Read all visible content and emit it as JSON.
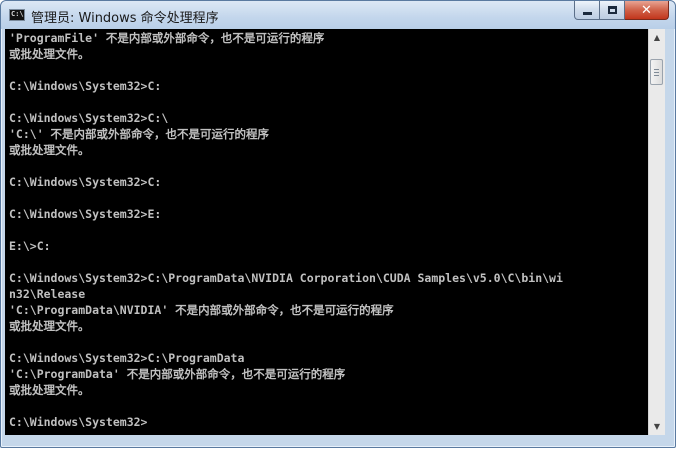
{
  "window": {
    "title": "管理员: Windows 命令处理程序",
    "icon_text": "C:\\",
    "buttons": {
      "minimize": "minimize-icon",
      "maximize": "maximize-icon",
      "close": "close-icon"
    }
  },
  "console": {
    "lines": [
      "'ProgramFile' 不是内部或外部命令，也不是可运行的程序",
      "或批处理文件。",
      "",
      "C:\\Windows\\System32>C:",
      "",
      "C:\\Windows\\System32>C:\\",
      "'C:\\' 不是内部或外部命令，也不是可运行的程序",
      "或批处理文件。",
      "",
      "C:\\Windows\\System32>C:",
      "",
      "C:\\Windows\\System32>E:",
      "",
      "E:\\>C:",
      "",
      "C:\\Windows\\System32>C:\\ProgramData\\NVIDIA Corporation\\CUDA Samples\\v5.0\\C\\bin\\wi",
      "n32\\Release",
      "'C:\\ProgramData\\NVIDIA' 不是内部或外部命令，也不是可运行的程序",
      "或批处理文件。",
      "",
      "C:\\Windows\\System32>C:\\ProgramData",
      "'C:\\ProgramData' 不是内部或外部命令，也不是可运行的程序",
      "或批处理文件。",
      "",
      "C:\\Windows\\System32>"
    ]
  },
  "colors": {
    "console_bg": "#000000",
    "console_text": "#c0c0c0",
    "titlebar": "#c3d6ec",
    "close_button": "#c2361c"
  }
}
